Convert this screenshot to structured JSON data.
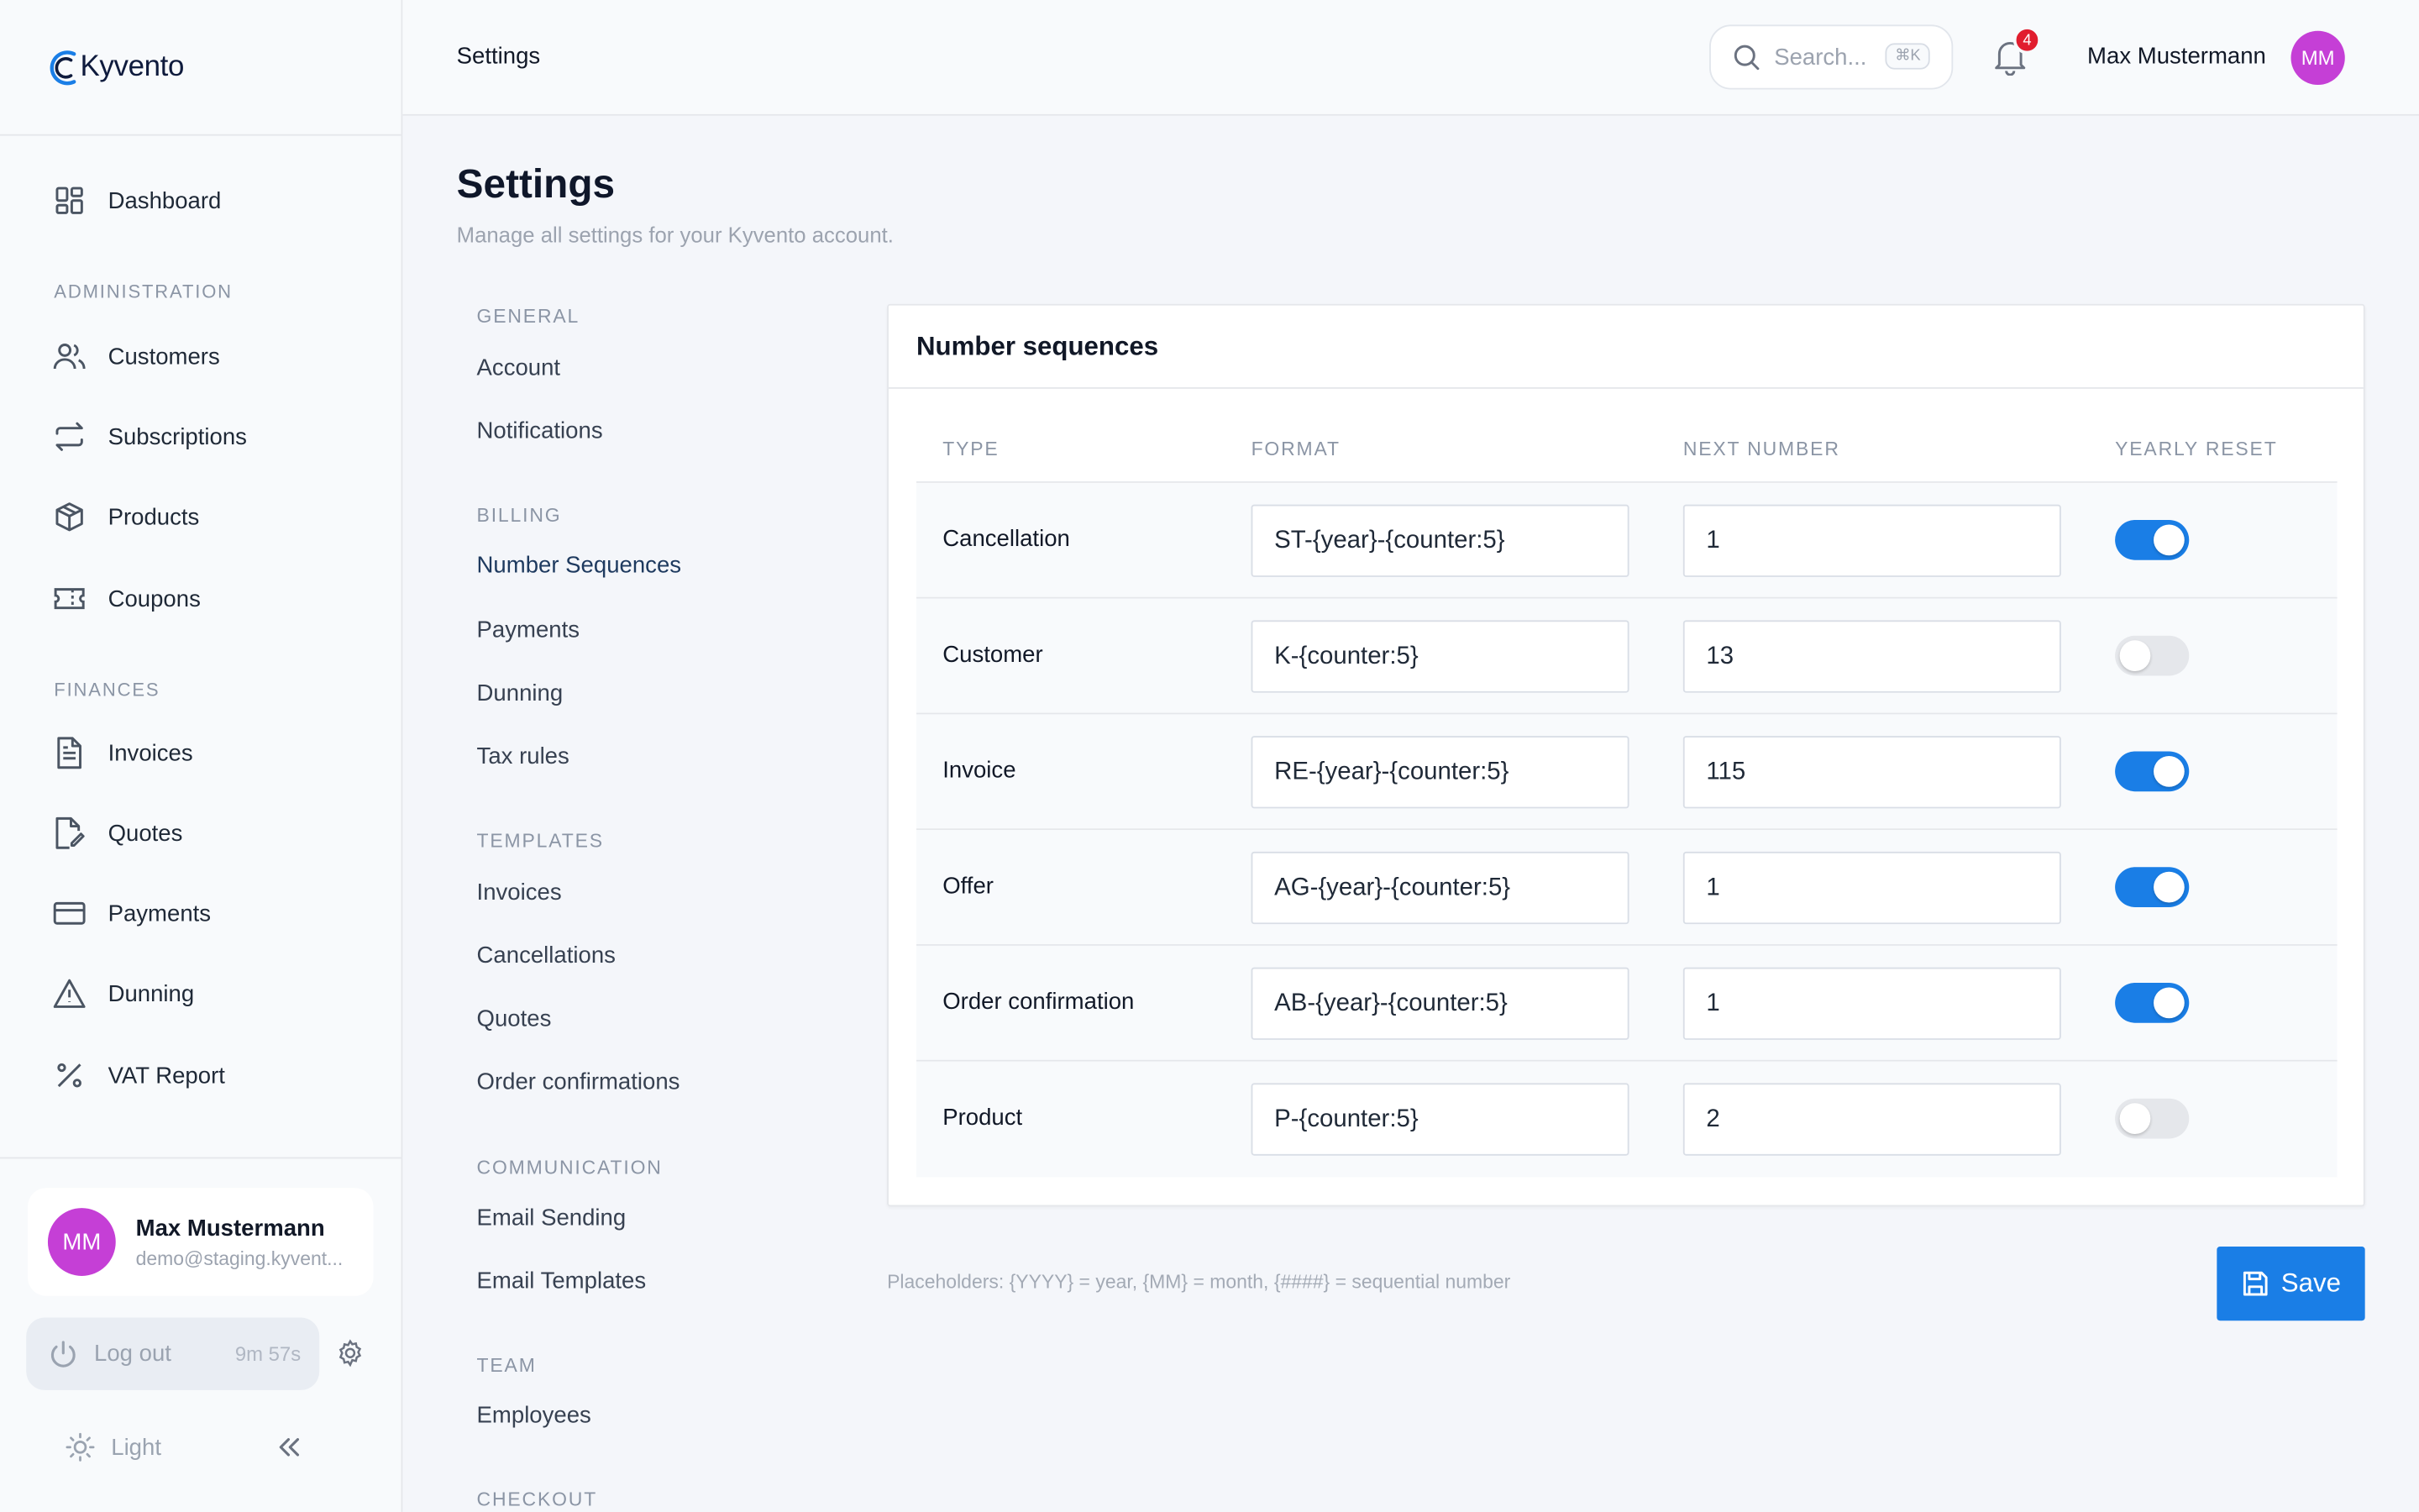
{
  "app": {
    "logo_text": "Kyvento"
  },
  "sidebar": {
    "dashboard": "Dashboard",
    "sections": [
      {
        "title": "ADMINISTRATION",
        "items": [
          "Customers",
          "Subscriptions",
          "Products",
          "Coupons"
        ]
      },
      {
        "title": "FINANCES",
        "items": [
          "Invoices",
          "Quotes",
          "Payments",
          "Dunning",
          "VAT Report"
        ]
      }
    ],
    "user": {
      "initials": "MM",
      "name": "Max Mustermann",
      "email": "demo@staging.kyvent..."
    },
    "logout_label": "Log out",
    "session_timer": "9m 57s",
    "theme_label": "Light"
  },
  "topbar": {
    "breadcrumb": "Settings",
    "search_placeholder": "Search...",
    "search_shortcut": "⌘K",
    "notification_count": "4",
    "user_name": "Max Mustermann",
    "user_initials": "MM"
  },
  "page": {
    "title": "Settings",
    "subtitle": "Manage all settings for your Kyvento account."
  },
  "settings_nav": [
    {
      "title": "GENERAL",
      "items": [
        "Account",
        "Notifications"
      ]
    },
    {
      "title": "BILLING",
      "items": [
        "Number Sequences",
        "Payments",
        "Dunning",
        "Tax rules"
      ]
    },
    {
      "title": "TEMPLATES",
      "items": [
        "Invoices",
        "Cancellations",
        "Quotes",
        "Order confirmations"
      ]
    },
    {
      "title": "COMMUNICATION",
      "items": [
        "Email Sending",
        "Email Templates"
      ]
    },
    {
      "title": "TEAM",
      "items": [
        "Employees"
      ]
    },
    {
      "title": "CHECKOUT",
      "items": []
    }
  ],
  "settings_nav_active": "Number Sequences",
  "card": {
    "title": "Number sequences",
    "columns": {
      "type": "TYPE",
      "format": "FORMAT",
      "next": "NEXT NUMBER",
      "reset": "YEARLY RESET"
    },
    "rows": [
      {
        "type": "Cancellation",
        "format": "ST-{year}-{counter:5}",
        "next": "1",
        "yearly_reset": true
      },
      {
        "type": "Customer",
        "format": "K-{counter:5}",
        "next": "13",
        "yearly_reset": false
      },
      {
        "type": "Invoice",
        "format": "RE-{year}-{counter:5}",
        "next": "115",
        "yearly_reset": true
      },
      {
        "type": "Offer",
        "format": "AG-{year}-{counter:5}",
        "next": "1",
        "yearly_reset": true
      },
      {
        "type": "Order confirmation",
        "format": "AB-{year}-{counter:5}",
        "next": "1",
        "yearly_reset": true
      },
      {
        "type": "Product",
        "format": "P-{counter:5}",
        "next": "2",
        "yearly_reset": false
      }
    ]
  },
  "hint": "Placeholders: {YYYY} = year, {MM} = month, {####} = sequential number",
  "save_label": "Save",
  "colors": {
    "accent": "#1a7ee6",
    "avatar": "#c53fd6",
    "badge": "#e11d2e"
  }
}
